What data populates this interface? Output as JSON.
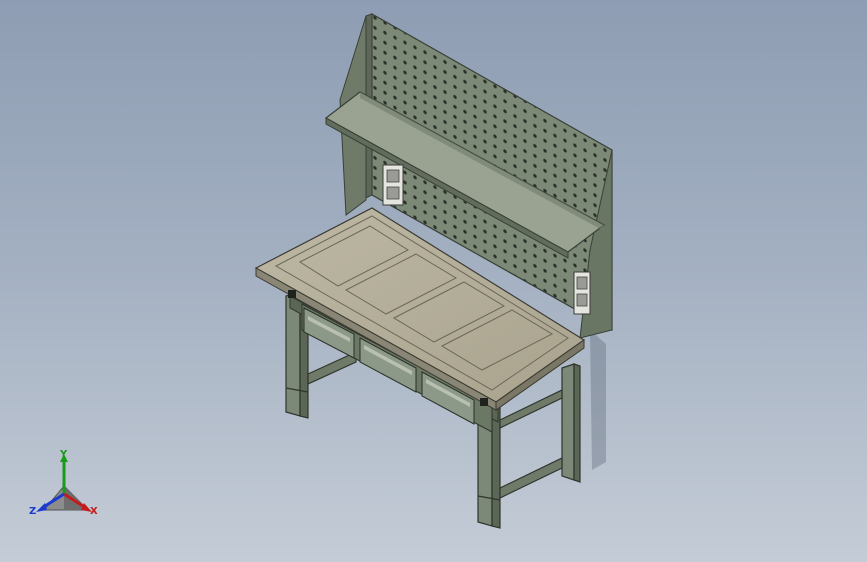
{
  "viewport": {
    "background_top": "#8e9db3",
    "background_bottom": "#c4ccd6",
    "model_color": "#6d7a6c",
    "top_color": "#b4ae9a"
  },
  "model": {
    "name": "workbench-with-pegboard",
    "drawer_count": 3,
    "outlet_count": 2,
    "tray_panels": 4
  },
  "triad": {
    "x_label": "X",
    "y_label": "Y",
    "z_label": "Z",
    "x_color": "#c41c1c",
    "y_color": "#1a9a1a",
    "z_color": "#1c3ad0"
  }
}
